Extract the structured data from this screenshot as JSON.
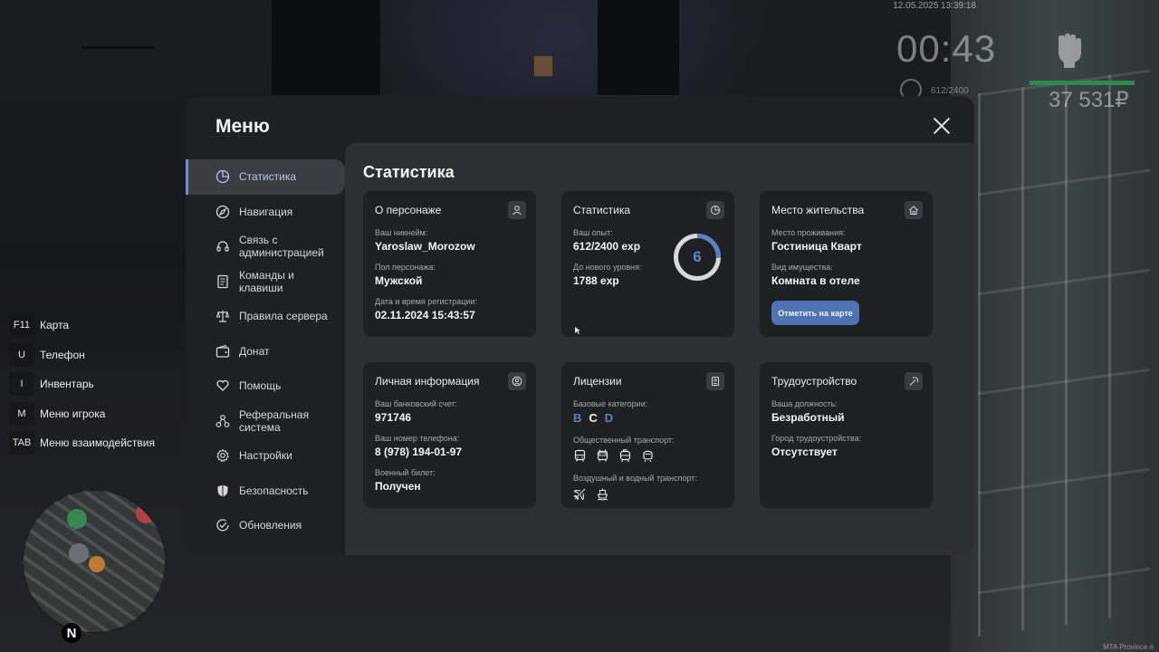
{
  "hud": {
    "datetime": "12.05.2025 13:39:18",
    "timer": "00:43",
    "exp": "612/2400",
    "money": "37 531₽",
    "watermark": "MTA Province #"
  },
  "hotkeys": [
    {
      "key": "F11",
      "label": "Карта"
    },
    {
      "key": "U",
      "label": "Телефон"
    },
    {
      "key": "I",
      "label": "Инвентарь"
    },
    {
      "key": "M",
      "label": "Меню игрока"
    },
    {
      "key": "TAB",
      "label": "Меню взаимодействия"
    }
  ],
  "minimap": {
    "north": "N"
  },
  "menu": {
    "title": "Меню",
    "sidebar": [
      {
        "label": "Статистика",
        "icon": "pie-chart-icon",
        "active": true
      },
      {
        "label": "Навигация",
        "icon": "compass-icon"
      },
      {
        "label": "Связь с администрацией",
        "icon": "headset-icon"
      },
      {
        "label": "Команды и клавиши",
        "icon": "document-icon"
      },
      {
        "label": "Правила сервера",
        "icon": "scales-icon"
      },
      {
        "label": "Донат",
        "icon": "wallet-icon"
      },
      {
        "label": "Помощь",
        "icon": "heart-hands-icon"
      },
      {
        "label": "Реферальная система",
        "icon": "network-icon"
      },
      {
        "label": "Настройки",
        "icon": "gear-icon"
      },
      {
        "label": "Безопасность",
        "icon": "shield-icon"
      },
      {
        "label": "Обновления",
        "icon": "check-circle-icon"
      }
    ],
    "content_title": "Статистика",
    "cards": {
      "character": {
        "title": "О персонаже",
        "nickname_label": "Ваш никнейм:",
        "nickname": "Yaroslaw_Morozow",
        "gender_label": "Пол персонажа:",
        "gender": "Мужской",
        "reg_label": "Дата и время регистрации:",
        "reg": "02.11.2024 15:43:57"
      },
      "stats": {
        "title": "Статистика",
        "exp_label": "Ваш опыт:",
        "exp": "612/2400 exp",
        "next_label": "До нового уровня:",
        "next": "1788 exp",
        "level": "6",
        "progress": 0.255
      },
      "residence": {
        "title": "Место жительства",
        "place_label": "Место проживания:",
        "place": "Гостиница Кварт",
        "type_label": "Вид имущества:",
        "type": "Комната в отеле",
        "button": "Отметить на карте"
      },
      "personal": {
        "title": "Личная информация",
        "bank_label": "Ваш банковский счет:",
        "bank": "971746",
        "phone_label": "Ваш номер телефона:",
        "phone": "8 (978) 194-01-97",
        "military_label": "Военный билет:",
        "military": "Получен"
      },
      "licenses": {
        "title": "Лицензии",
        "base_label": "Базовые категории:",
        "categories": [
          {
            "letter": "B",
            "color": "#5b7fc4"
          },
          {
            "letter": "C",
            "color": "#f2f2f2"
          },
          {
            "letter": "D",
            "color": "#5b7fc4"
          }
        ],
        "public_label": "Общественный транспорт:",
        "air_label": "Воздушный и водный транспорт:"
      },
      "job": {
        "title": "Трудоустройство",
        "position_label": "Ваша должность:",
        "position": "Безработный",
        "city_label": "Город трудоустройства:",
        "city": "Отсутствует"
      }
    }
  },
  "colors": {
    "accent": "#5b7fc4",
    "button": "#4f72b3",
    "panel": "#1f2023",
    "content": "#2e2f32",
    "hud_bar": "#2e8a4b"
  }
}
